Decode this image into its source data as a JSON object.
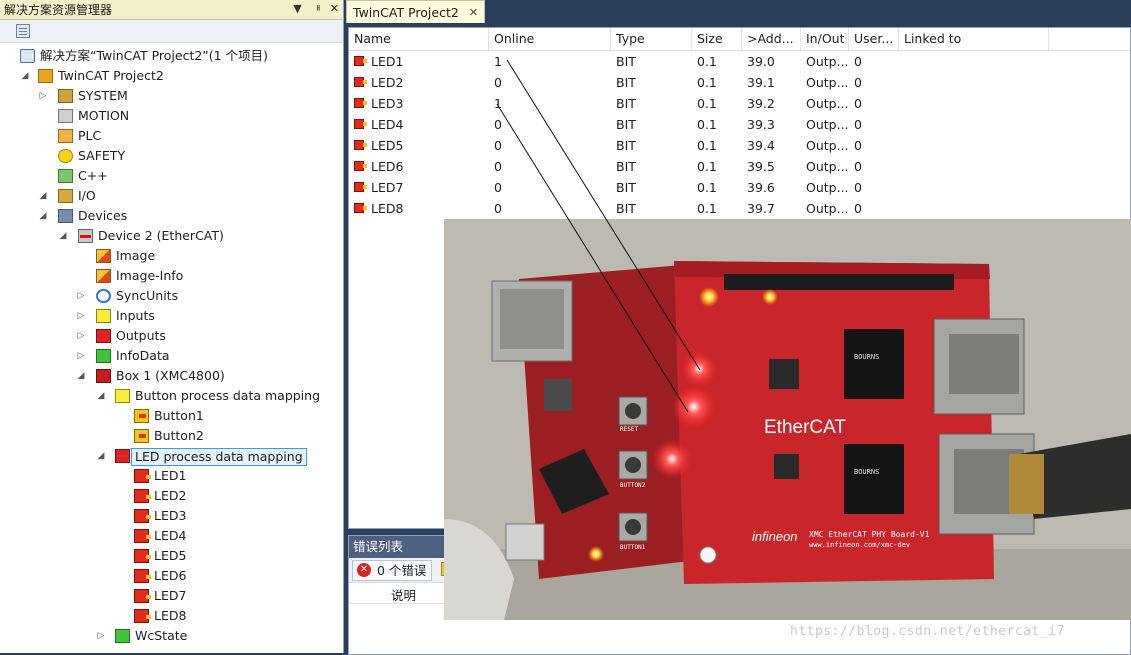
{
  "solution_explorer": {
    "title": "解决方案资源管理器",
    "controls": [
      "▼",
      "ᅢ",
      "✕"
    ],
    "tree": [
      {
        "label": "解决方案“TwinCAT Project2”(1 个项目)",
        "icon": "solution-icon",
        "level": 0,
        "arrow": ""
      },
      {
        "label": "TwinCAT Project2",
        "icon": "project-icon",
        "level": 1,
        "arrow": "◢"
      },
      {
        "label": "SYSTEM",
        "icon": "system-icon",
        "level": 2,
        "arrow": "▷"
      },
      {
        "label": "MOTION",
        "icon": "motion-icon",
        "level": 2,
        "arrow": ""
      },
      {
        "label": "PLC",
        "icon": "plc-icon",
        "level": 2,
        "arrow": ""
      },
      {
        "label": "SAFETY",
        "icon": "safety-icon",
        "level": 2,
        "arrow": ""
      },
      {
        "label": "C++",
        "icon": "cpp-icon",
        "level": 2,
        "arrow": ""
      },
      {
        "label": "I/O",
        "icon": "io-icon",
        "level": 2,
        "arrow": "◢"
      },
      {
        "label": "Devices",
        "icon": "devices-icon",
        "level": 3,
        "arrow": "◢"
      },
      {
        "label": "Device 2 (EtherCAT)",
        "icon": "ethercat-device-icon",
        "level": 4,
        "arrow": "◢"
      },
      {
        "label": "Image",
        "icon": "image-icon",
        "level": 5,
        "arrow": ""
      },
      {
        "label": "Image-Info",
        "icon": "image-info-icon",
        "level": 5,
        "arrow": ""
      },
      {
        "label": "SyncUnits",
        "icon": "sync-units-icon",
        "level": 5,
        "arrow": "▷"
      },
      {
        "label": "Inputs",
        "icon": "inputs-icon",
        "level": 5,
        "arrow": "▷"
      },
      {
        "label": "Outputs",
        "icon": "outputs-icon",
        "level": 5,
        "arrow": "▷"
      },
      {
        "label": "InfoData",
        "icon": "infodata-icon",
        "level": 5,
        "arrow": "▷"
      },
      {
        "label": "Box 1 (XMC4800)",
        "icon": "box-icon",
        "level": 5,
        "arrow": "◢"
      },
      {
        "label": "Button process data mapping",
        "icon": "input-mapping-icon",
        "level": 6,
        "arrow": "◢"
      },
      {
        "label": "Button1",
        "icon": "button-var-icon",
        "level": 7,
        "arrow": ""
      },
      {
        "label": "Button2",
        "icon": "button-var-icon",
        "level": 7,
        "arrow": ""
      },
      {
        "label": "LED process data mapping",
        "icon": "output-mapping-icon",
        "level": 6,
        "arrow": "◢",
        "selected": true
      },
      {
        "label": "LED1",
        "icon": "led-var-icon",
        "level": 7,
        "arrow": ""
      },
      {
        "label": "LED2",
        "icon": "led-var-icon",
        "level": 7,
        "arrow": ""
      },
      {
        "label": "LED3",
        "icon": "led-var-icon",
        "level": 7,
        "arrow": ""
      },
      {
        "label": "LED4",
        "icon": "led-var-icon",
        "level": 7,
        "arrow": ""
      },
      {
        "label": "LED5",
        "icon": "led-var-icon",
        "level": 7,
        "arrow": ""
      },
      {
        "label": "LED6",
        "icon": "led-var-icon",
        "level": 7,
        "arrow": ""
      },
      {
        "label": "LED7",
        "icon": "led-var-icon",
        "level": 7,
        "arrow": ""
      },
      {
        "label": "LED8",
        "icon": "led-var-icon",
        "level": 7,
        "arrow": ""
      },
      {
        "label": "WcState",
        "icon": "wcstate-icon",
        "level": 6,
        "arrow": "▷"
      }
    ]
  },
  "document_tab": {
    "label": "TwinCAT Project2",
    "close": "✕"
  },
  "grid": {
    "columns": [
      "Name",
      "Online",
      "Type",
      "Size",
      ">Add...",
      "In/Out",
      "User...",
      "Linked to"
    ],
    "rows": [
      [
        "LED1",
        "1",
        "BIT",
        "0.1",
        "39.0",
        "Outp...",
        "0",
        ""
      ],
      [
        "LED2",
        "0",
        "BIT",
        "0.1",
        "39.1",
        "Outp...",
        "0",
        ""
      ],
      [
        "LED3",
        "1",
        "BIT",
        "0.1",
        "39.2",
        "Outp...",
        "0",
        ""
      ],
      [
        "LED4",
        "0",
        "BIT",
        "0.1",
        "39.3",
        "Outp...",
        "0",
        ""
      ],
      [
        "LED5",
        "0",
        "BIT",
        "0.1",
        "39.4",
        "Outp...",
        "0",
        ""
      ],
      [
        "LED6",
        "0",
        "BIT",
        "0.1",
        "39.5",
        "Outp...",
        "0",
        ""
      ],
      [
        "LED7",
        "0",
        "BIT",
        "0.1",
        "39.6",
        "Outp...",
        "0",
        ""
      ],
      [
        "LED8",
        "0",
        "BIT",
        "0.1",
        "39.7",
        "Outp...",
        "0",
        ""
      ]
    ]
  },
  "error_list": {
    "title": "错误列表",
    "errors_button": "0 个错误",
    "description_header": "说明"
  },
  "photo": {
    "board_labels": {
      "ethercat": "EtherCAT",
      "brand": "infineon",
      "caption": "XMC EtherCAT PHY Board-V1",
      "url": "www.infineon.com/xmc-dev",
      "reset": "RESET",
      "button1": "BUTTON1",
      "button2": "BUTTON2",
      "bourns": "BOURNS"
    }
  },
  "watermark": "https://blog.csdn.net/ethercat_i7"
}
